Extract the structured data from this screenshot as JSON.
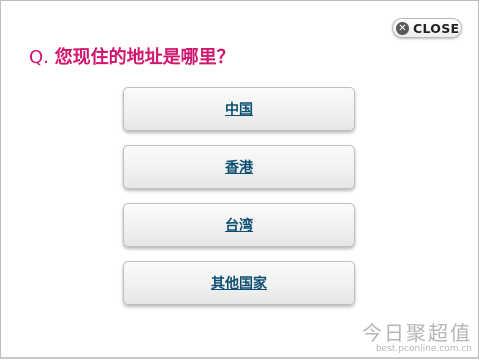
{
  "close_button": {
    "label": "CLOSE",
    "icon": "close-icon"
  },
  "question": {
    "prefix": "Q.",
    "text": "您现住的地址是哪里？"
  },
  "options": [
    {
      "label": "中国"
    },
    {
      "label": "香港"
    },
    {
      "label": "台湾"
    },
    {
      "label": "其他国家"
    }
  ],
  "watermark": {
    "title": "今日聚超值",
    "url": "best.pconline.com.cn"
  },
  "colors": {
    "question_color": "#d0166e",
    "option_text_color": "#0d4f72"
  }
}
